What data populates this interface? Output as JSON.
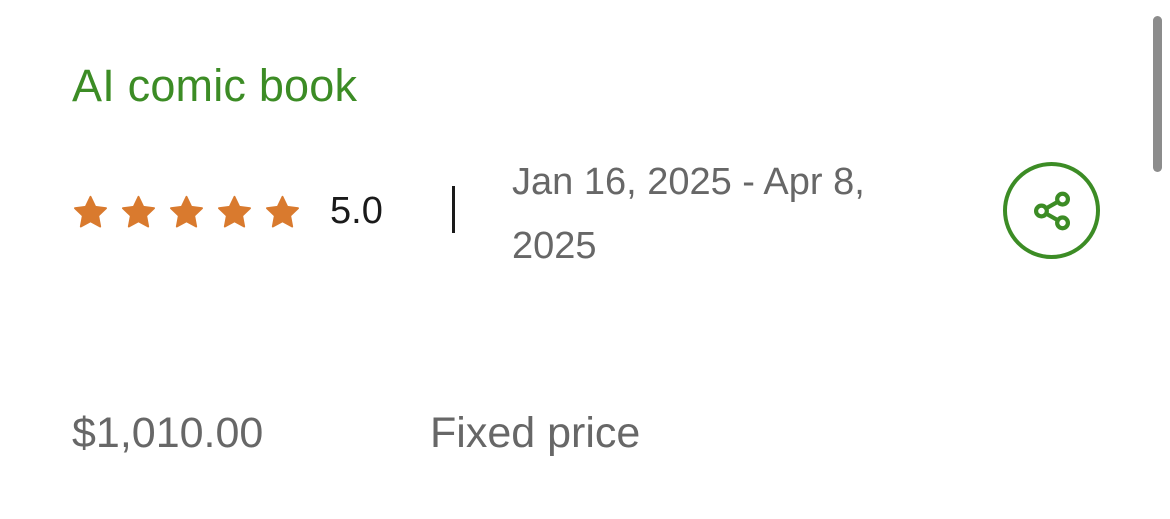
{
  "job": {
    "title": "AI comic book",
    "rating": {
      "stars": 5,
      "max_stars": 5,
      "value_label": "5.0",
      "star_color": "#d97a2e"
    },
    "dates": "Jan 16, 2025 - Apr 8, 2025",
    "price": "$1,010.00",
    "budget_type": "Fixed price"
  },
  "actions": {
    "share_icon": "share-icon"
  },
  "colors": {
    "accent": "#3c8c25",
    "muted_text": "#676767",
    "primary_text": "#1a1a1a"
  }
}
